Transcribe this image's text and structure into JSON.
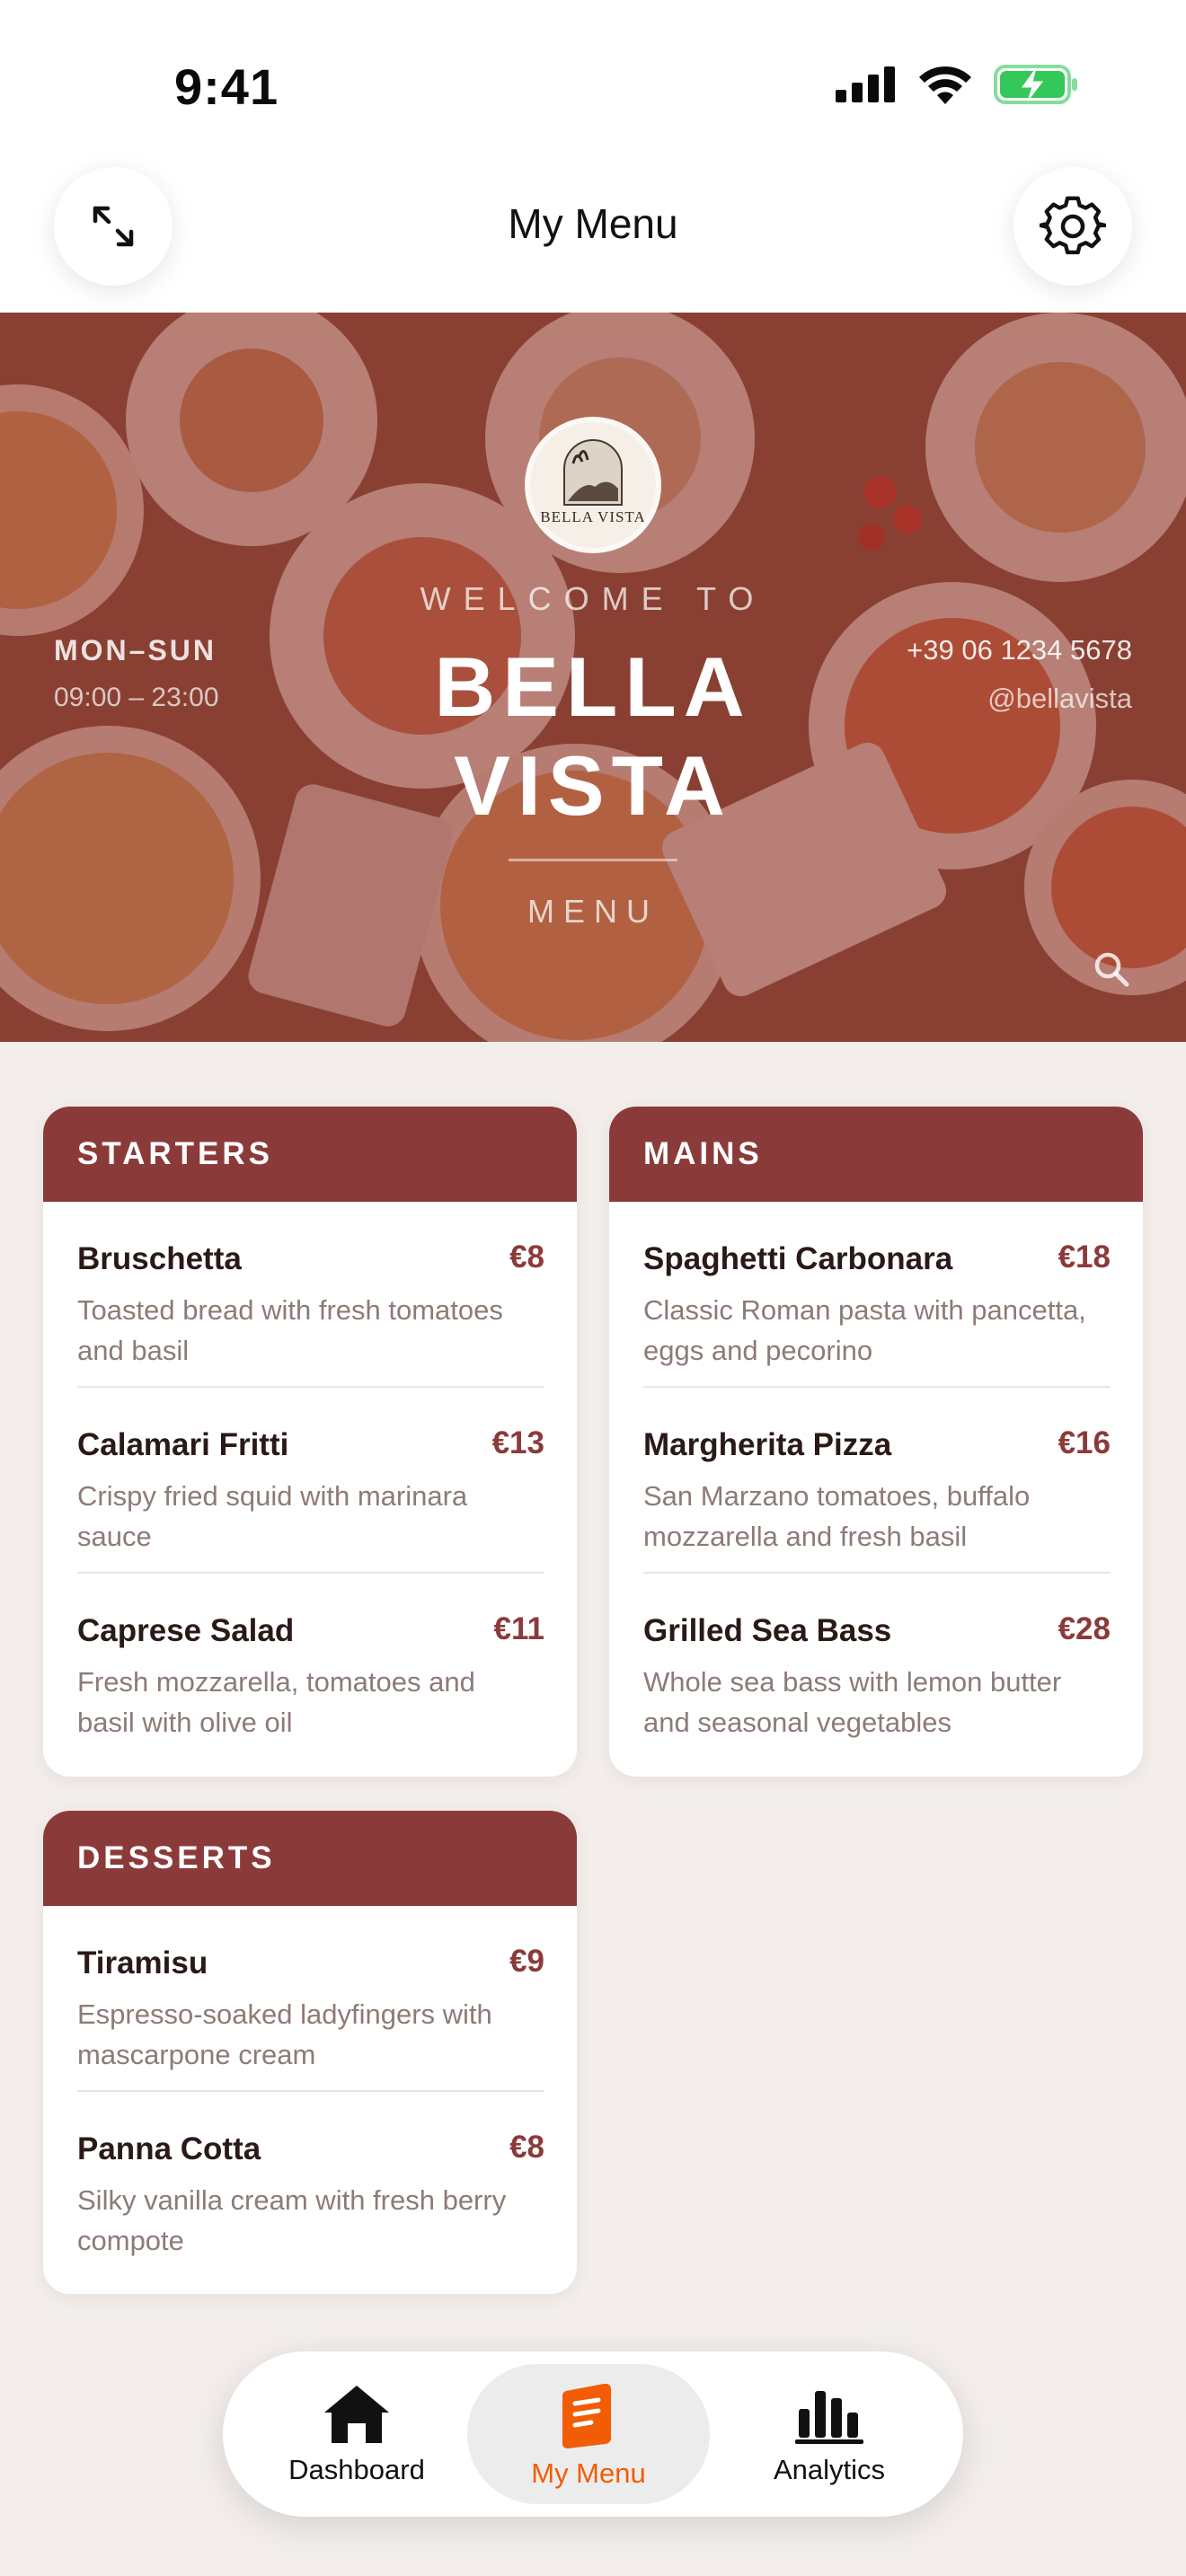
{
  "status_bar": {
    "time": "9:41"
  },
  "header": {
    "title": "My Menu",
    "left_icon": "expand-icon",
    "right_icon": "gear-icon"
  },
  "hero": {
    "logo_text": "BELLA VISTA",
    "welcome": "WELCOME TO",
    "title_line1": "BELLA",
    "title_line2": "VISTA",
    "subtitle": "MENU",
    "days": "MON–SUN",
    "hours": "09:00 – 23:00",
    "phone": "+39 06 1234 5678",
    "handle": "@bellavista",
    "search_icon": "search-icon"
  },
  "sections": [
    {
      "title": "STARTERS",
      "items": [
        {
          "name": "Bruschetta",
          "price": "€8",
          "desc": "Toasted bread with fresh tomatoes and basil"
        },
        {
          "name": "Calamari Fritti",
          "price": "€13",
          "desc": "Crispy fried squid with marinara sauce"
        },
        {
          "name": "Caprese Salad",
          "price": "€11",
          "desc": "Fresh mozzarella, tomatoes and basil with olive oil"
        }
      ]
    },
    {
      "title": "MAINS",
      "items": [
        {
          "name": "Spaghetti Carbonara",
          "price": "€18",
          "desc": "Classic Roman pasta with pancetta, eggs and pecorino"
        },
        {
          "name": "Margherita Pizza",
          "price": "€16",
          "desc": "San Marzano tomatoes, buffalo mozzarella and fresh basil"
        },
        {
          "name": "Grilled Sea Bass",
          "price": "€28",
          "desc": "Whole sea bass with lemon butter and seasonal vegetables"
        }
      ]
    },
    {
      "title": "DESSERTS",
      "items": [
        {
          "name": "Tiramisu",
          "price": "€9",
          "desc": "Espresso-soaked ladyfingers with mascarpone cream"
        },
        {
          "name": "Panna Cotta",
          "price": "€8",
          "desc": "Silky vanilla cream with fresh berry compote"
        }
      ]
    }
  ],
  "tabbar": {
    "tabs": [
      {
        "label": "Dashboard",
        "icon": "home-icon"
      },
      {
        "label": "My Menu",
        "icon": "menu-book-icon",
        "active": true
      },
      {
        "label": "Analytics",
        "icon": "bar-chart-icon"
      }
    ]
  },
  "colors": {
    "accent": "#8b3a3a",
    "active_tab": "#f25c05",
    "background": "#f3eeeb"
  }
}
